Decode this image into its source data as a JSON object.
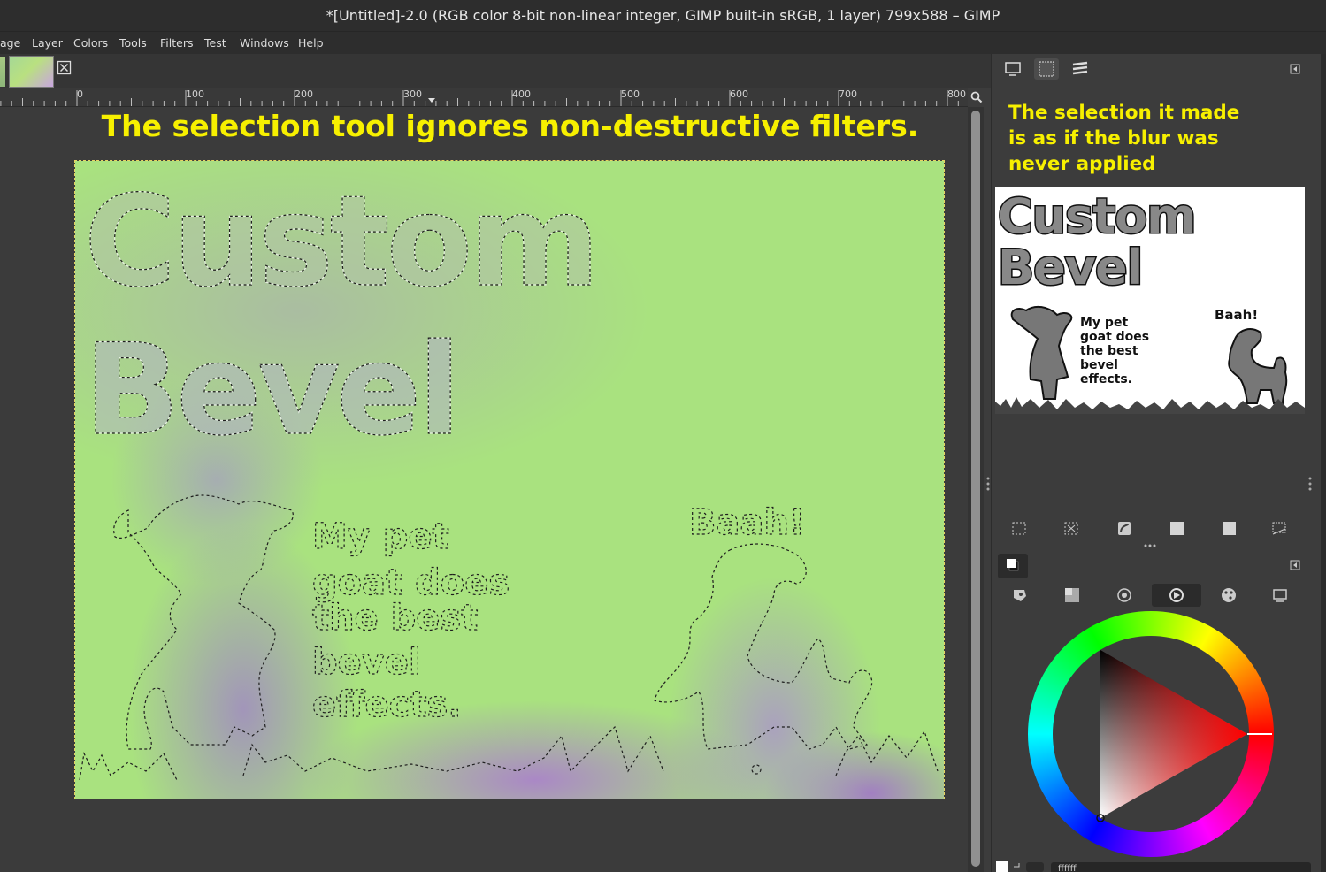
{
  "window": {
    "title": "*[Untitled]-2.0 (RGB color 8-bit non-linear integer, GIMP built-in sRGB, 1 layer) 799x588 – GIMP"
  },
  "menu": [
    "age",
    "Layer",
    "Colors",
    "Tools",
    "Filters",
    "Test",
    "Windows",
    "Help"
  ],
  "ruler": {
    "labels": [
      "0",
      "100",
      "200",
      "300",
      "400",
      "500",
      "600",
      "700",
      "800"
    ]
  },
  "canvas": {
    "headline": "The selection tool ignores non-destructive filters.",
    "text_custom": "Custom",
    "text_bevel": "Bevel",
    "text_pet": [
      "My pet",
      "goat does",
      "the best",
      "bevel",
      "effects."
    ],
    "text_baah": "Baah!"
  },
  "panel": {
    "note_lines": [
      "The selection it made",
      "is as if the blur was",
      "never applied"
    ],
    "preview": {
      "line1": "Custom",
      "line2": "Bevel",
      "pet_lines": [
        "My pet",
        "goat does",
        "the best",
        "bevel",
        "effects."
      ],
      "baah": "Baah!"
    },
    "color_hex": "ffffff"
  },
  "icons": {
    "dock_tabs": [
      "images-icon",
      "selection-editor-icon",
      "layers-icon"
    ],
    "select_row": [
      "select-all-icon",
      "select-none-icon",
      "invert-selection-icon",
      "selection-square-icon",
      "selection-sharpen-icon",
      "selection-to-path-icon"
    ],
    "color_modes": [
      "gimp-selector-icon",
      "cmyk-selector-icon",
      "watercolor-selector-icon",
      "wheel-selector-icon",
      "palette-selector-icon",
      "scales-selector-icon"
    ]
  },
  "colors": {
    "accent_yellow": "#f7f000",
    "canvas_green": "#a9e27f",
    "blur_purple": "#a878d0",
    "hue_marker": "#ff0000"
  }
}
